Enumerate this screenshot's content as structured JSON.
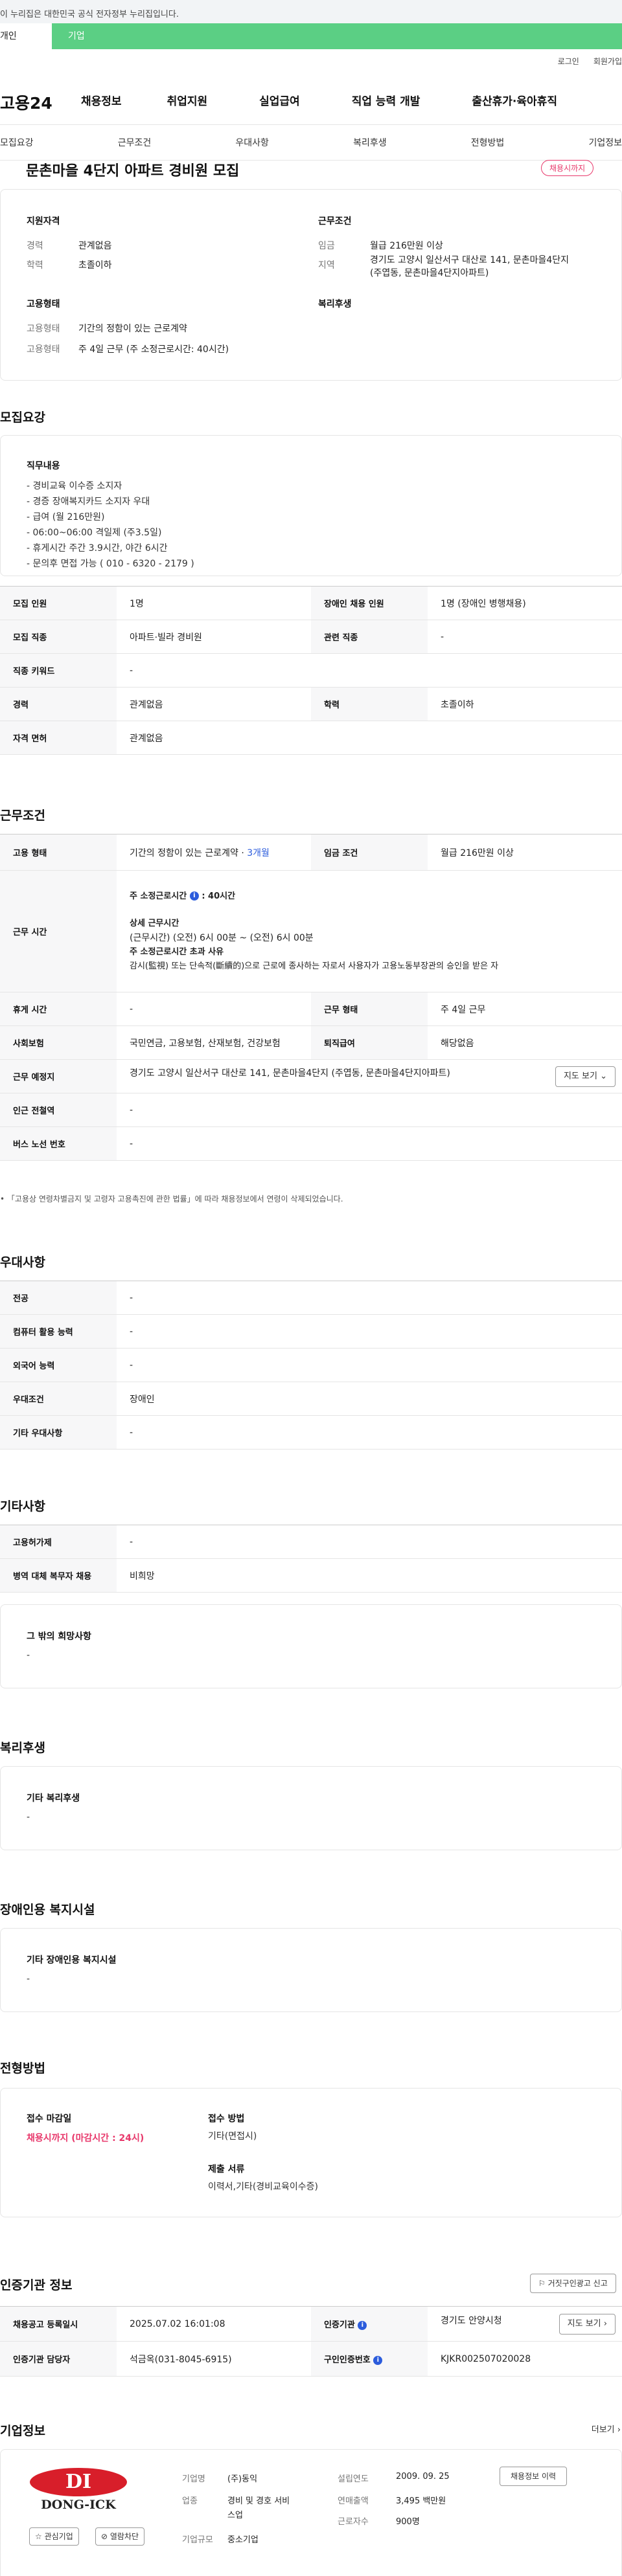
{
  "gov_banner": "이 누리집은 대한민국 공식 전자정부 누리집입니다.",
  "tabs": [
    "개인",
    "기업"
  ],
  "util": [
    "로그인",
    "회원가입"
  ],
  "logo": "고용24",
  "gnb": [
    "채용정보",
    "취업지원",
    "실업급여",
    "직업 능력 개발",
    "출산휴가·육아휴직"
  ],
  "subnav": [
    "모집요강",
    "근무조건",
    "우대사항",
    "복리후생",
    "전형방법",
    "기업정보"
  ],
  "title": "문촌마을 4단지 아파트 경비원 모집",
  "badge": "채용시까지",
  "summary": {
    "qual_h": "지원자격",
    "exp_k": "경력",
    "exp_v": "관계없음",
    "edu_k": "학력",
    "edu_v": "초졸이하",
    "emp_h": "고용형태",
    "emp1_k": "고용형태",
    "emp1_v": "기간의 정함이 있는 근로계약",
    "emp2_k": "고용형태",
    "emp2_v": "주 4일 근무 (주 소정근로시간: 40시간)",
    "cond_h": "근무조건",
    "wage_k": "임금",
    "wage_v": "월급 216만원 이상",
    "area_k": "지역",
    "area_v1": "경기도 고양시 일산서구 대산로 141, 문촌마을4단지",
    "area_v2": "(주엽동, 문촌마을4단지아파트)",
    "welfare_h": "복리후생"
  },
  "recruit": {
    "heading": "모집요강",
    "job_h": "직무내용",
    "job_lines": [
      "- 경비교육 이수증 소지자",
      "- 경증 장애복지카드 소지자 우대",
      "- 급여 (월 216만원)",
      "- 06:00~06:00 격일제 (주3.5일)",
      "- 휴게시간 주간 3.9시간, 야간 6시간",
      "- 문의후 면접 가능 ( 010 - 6320 - 2179 )"
    ],
    "rows": [
      {
        "k1": "모집 인원",
        "v1": "1명",
        "k2": "장애인 채용 인원",
        "v2": "1명 (장애인 병행채용)"
      },
      {
        "k1": "모집 직종",
        "v1": "아파트·빌라 경비원",
        "k2": "관련 직종",
        "v2": "-"
      },
      {
        "k1": "직종 키워드",
        "v1": "-"
      },
      {
        "k1": "경력",
        "v1": "관계없음",
        "k2": "학력",
        "v2": "초졸이하"
      },
      {
        "k1": "자격 면허",
        "v1": "관계없음"
      }
    ]
  },
  "conditions": {
    "heading": "근무조건",
    "emp_k": "고용 형태",
    "emp_v": "기간의 정함이 있는 근로계약 · ",
    "emp_link": "3개월",
    "wage_k": "임금 조건",
    "wage_v": "월급 216만원 이상",
    "time_k": "근무 시간",
    "time_main": "주 소정근로시간",
    "time_main_v": ": 40시간",
    "time_detail_h": "상세 근무시간",
    "time_detail_v": "(근무시간) (오전) 6시 00분 ~ (오전) 6시 00분",
    "time_over_h": "주 소정근로시간 초과 사유",
    "time_over_v": "감시(監視) 또는 단속적(斷續的)으로 근로에 종사하는 자로서 사용자가 고용노동부장관의 승인을 받은 자",
    "rest_k": "휴게 시간",
    "rest_v": "-",
    "type_k": "근무 형태",
    "type_v": "주 4일 근무",
    "ins_k": "사회보험",
    "ins_v": "국민연금, 고용보험, 산재보험, 건강보험",
    "sev_k": "퇴직급여",
    "sev_v": "해당없음",
    "place_k": "근무 예정지",
    "place_v": "경기도 고양시 일산서구 대산로 141, 문촌마을4단지 (주엽동, 문촌마을4단지아파트)",
    "map_btn": "지도 보기",
    "sub_k": "인근 전철역",
    "sub_v": "-",
    "bus_k": "버스 노선 번호",
    "bus_v": "-",
    "note": "「고용상 연령차별금지 및 고령자 고용촉진에 관한 법률」에 따라 채용정보에서 연령이 삭제되었습니다."
  },
  "pref": {
    "heading": "우대사항",
    "rows": [
      {
        "k": "전공",
        "v": "-"
      },
      {
        "k": "컴퓨터 활용 능력",
        "v": "-"
      },
      {
        "k": "외국어 능력",
        "v": "-"
      },
      {
        "k": "우대조건",
        "v": "장애인"
      },
      {
        "k": "기타 우대사항",
        "v": "-"
      }
    ]
  },
  "etc": {
    "heading": "기타사항",
    "rows": [
      {
        "k": "고용허가제",
        "v": "-"
      },
      {
        "k": "병역 대체 복무자 채용",
        "v": "비희망"
      }
    ],
    "other_h": "그 밖의 희망사항",
    "other_v": "-"
  },
  "welfare": {
    "heading": "복리후생",
    "h": "기타 복리후생",
    "v": "-"
  },
  "disabled": {
    "heading": "장애인용 복지시설",
    "h": "기타 장애인용 복지시설",
    "v": "-"
  },
  "selection": {
    "heading": "전형방법",
    "deadline_h": "접수 마감일",
    "deadline_v": "채용시까지 (마감시간 : 24시)",
    "method_h": "접수 방법",
    "method_v": "기타(면접시)",
    "docs_h": "제출 서류",
    "docs_v": "이력서,기타(경비교육이수증)"
  },
  "agency": {
    "heading": "인증기관 정보",
    "report_btn": "거짓구인광고 신고",
    "reg_k": "채용공고 등록일시",
    "reg_v": "2025.07.02 16:01:08",
    "org_k": "인증기관",
    "org_v": "경기도 안양시청",
    "mgr_k": "인증기관 담당자",
    "mgr_v": "석금옥(031-8045-6915)",
    "num_k": "구인인증번호",
    "num_v": "KJKR002507020028",
    "map_btn": "지도 보기"
  },
  "company": {
    "heading": "기업정보",
    "more": "더보기",
    "logo_main": "DI",
    "logo_sub": "DONG-ICK",
    "fav_btn": "관심기업",
    "block_btn": "열람차단",
    "name_k": "기업명",
    "name_v": "(주)동익",
    "ind_k": "업종",
    "ind_v1": "경비 및 경호 서비",
    "ind_v2": "스업",
    "size_k": "기업규모",
    "size_v": "중소기업",
    "est_k": "설립연도",
    "est_v": "2009. 09. 25",
    "rev_k": "연매출액",
    "rev_v": "3,495 백만원",
    "emp_k": "근로자수",
    "emp_v": "900명",
    "hist_btn": "채용정보 이력"
  },
  "colors": {
    "green": "#5bcf84",
    "pink": "#e8386b",
    "blue": "#2c5cdc",
    "logo_red": "#d81e2a"
  }
}
